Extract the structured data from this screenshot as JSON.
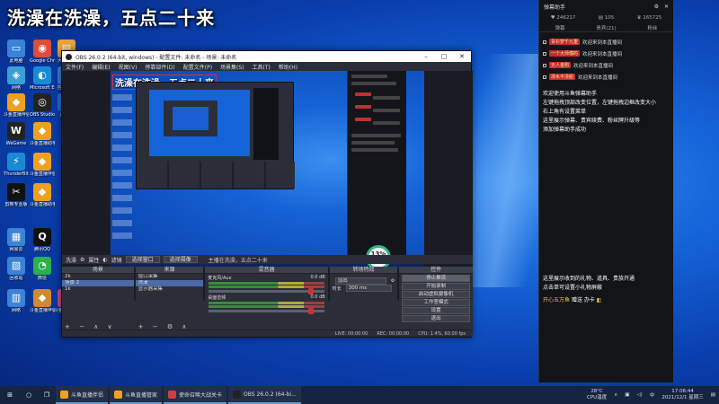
{
  "overlay_text": "洗澡在洗澡，五点二十来",
  "desktop_icons": [
    {
      "name": "此电脑",
      "color": "#3a83d6",
      "glyph": "▭"
    },
    {
      "name": "Google Chrome",
      "color": "#e04b3a",
      "glyph": "◉"
    },
    {
      "name": "大学英语",
      "color": "#e8a43a",
      "glyph": "▤"
    },
    {
      "name": "网络",
      "color": "#3aa0d6",
      "glyph": "◈"
    },
    {
      "name": "Microsoft Edge",
      "color": "#1b8ad6",
      "glyph": "◐"
    },
    {
      "name": "控制面板",
      "color": "#3a83d6",
      "glyph": "▦"
    },
    {
      "name": "斗鱼直播伴侣",
      "color": "#f0a020",
      "glyph": "◆"
    },
    {
      "name": "OBS Studio",
      "color": "#222",
      "glyph": "◎"
    },
    {
      "name": "此电脑",
      "color": "#2b6fd0",
      "glyph": "▭"
    },
    {
      "name": "WeGame",
      "color": "#222",
      "glyph": "W"
    },
    {
      "name": "斗鱼直播助手",
      "color": "#f0a020",
      "glyph": "◆"
    },
    {
      "name": "ThunderBit",
      "color": "#1b8ad6",
      "glyph": "⚡"
    },
    {
      "name": "斗鱼直播伴侣",
      "color": "#f0a020",
      "glyph": "◆"
    },
    {
      "name": "剪映专业版",
      "color": "#111",
      "glyph": "✂"
    },
    {
      "name": "斗鱼直播助手",
      "color": "#f0a020",
      "glyph": "◆"
    },
    {
      "name": "腾讯QQ",
      "color": "#111",
      "glyph": "Q"
    },
    {
      "name": "网易云",
      "color": "#3a83d6",
      "glyph": "▦"
    },
    {
      "name": "回收站",
      "color": "#3a83d6",
      "glyph": "▧"
    },
    {
      "name": "微信",
      "color": "#29b14a",
      "glyph": "◔"
    },
    {
      "name": "网络",
      "color": "#3a83d6",
      "glyph": "▥"
    },
    {
      "name": "斗鱼直播伴侣",
      "color": "#d08a30",
      "glyph": "◆"
    },
    {
      "name": "斗鱼直播伴侣",
      "color": "#d04a8a",
      "glyph": "◆"
    }
  ],
  "obs": {
    "title": "OBS 26.0.2 (64-bit, windows) - 配置文件: 未命名 - 场景: 未命名",
    "menu": [
      "文件(F)",
      "编辑(E)",
      "视图(V)",
      "停靠部件(D)",
      "配置文件(P)",
      "场景集(S)",
      "工具(T)",
      "帮助(H)"
    ],
    "preview_overlay": "洗澡在洗澡，五点二十来",
    "badge_value": "13%",
    "badge_sub": "0.0K/s",
    "controls": {
      "source_label": "洗澡",
      "properties": "属性",
      "filters": "滤镜",
      "window_btn": "选择窗口",
      "scene_btn": "选择摄像",
      "current_scene": "主播在洗澡，五点二十来"
    },
    "docks": {
      "scenes_title": "场景",
      "scenes": [
        "2k",
        "场景 2",
        "1k"
      ],
      "sources_title": "来源",
      "sources": [
        "窗口采集",
        "洗澡",
        "显示器采集"
      ],
      "mixer_title": "混音器",
      "mixer": [
        {
          "name": "麦克风/Aux",
          "level": "0.0 dB"
        },
        {
          "name": "桌面音频",
          "level": "0.0 dB"
        }
      ],
      "transitions_title": "转场特效",
      "transition_type": "淡出",
      "duration_label": "时长",
      "duration_value": "300 ms",
      "controls_title": "控件",
      "control_buttons": [
        "停止推流",
        "开始录制",
        "启动虚拟摄像机",
        "工作室模式",
        "设置",
        "退出"
      ]
    },
    "status": {
      "live": "LIVE: 00:00:00",
      "rec": "REC: 00:00:00",
      "cpu": "CPU: 1.4%, 60.00 fps"
    }
  },
  "assistant": {
    "title": "弹幕助手",
    "stats": [
      {
        "icon": "♥",
        "value": "246217"
      },
      {
        "icon": "▤",
        "value": "105"
      },
      {
        "icon": "♛",
        "value": "165725"
      }
    ],
    "tabs": [
      "弹幕",
      "贵宾(21)",
      "粉丝"
    ],
    "messages": [
      {
        "tag": "青衫梦千九重",
        "text": "欢迎来到本直播间"
      },
      {
        "tag": "一个大师傅的",
        "text": "欢迎来到本直播间"
      },
      {
        "tag": "无人金刚",
        "text": "欢迎来到本直播间"
      },
      {
        "tag": "漂水不漂船",
        "text": "欢迎来到本直播间"
      }
    ],
    "sys_lines": [
      "欢迎使用斗鱼弹幕助手",
      "左键拖拽顶部改变位置，左键拖拽边框改变大小",
      "右上角有设置菜单",
      "这里展示弹幕、贵宾续费、粉丝牌升级等",
      "添加弹幕助手成功"
    ],
    "sys2_lines": [
      "这里展示收到的礼物、道具、贵族开通",
      "点击单可设置小礼物屏蔽"
    ],
    "gift_user": "开心五万鱼",
    "gift_text": "赠送 办卡"
  },
  "taskbar": {
    "apps": [
      {
        "label": "斗鱼直播伴侣",
        "color": "#f0a020"
      },
      {
        "label": "斗鱼直播管家",
        "color": "#f0a020"
      },
      {
        "label": "使命召唤大战关卡",
        "color": "#d04040"
      },
      {
        "label": "OBS 26.0.2 (64-bi...",
        "color": "#222"
      }
    ],
    "temp": "28°C",
    "cpu": "CPU温度",
    "time": "17:06:44",
    "date": "2021/12/1 星期三"
  }
}
